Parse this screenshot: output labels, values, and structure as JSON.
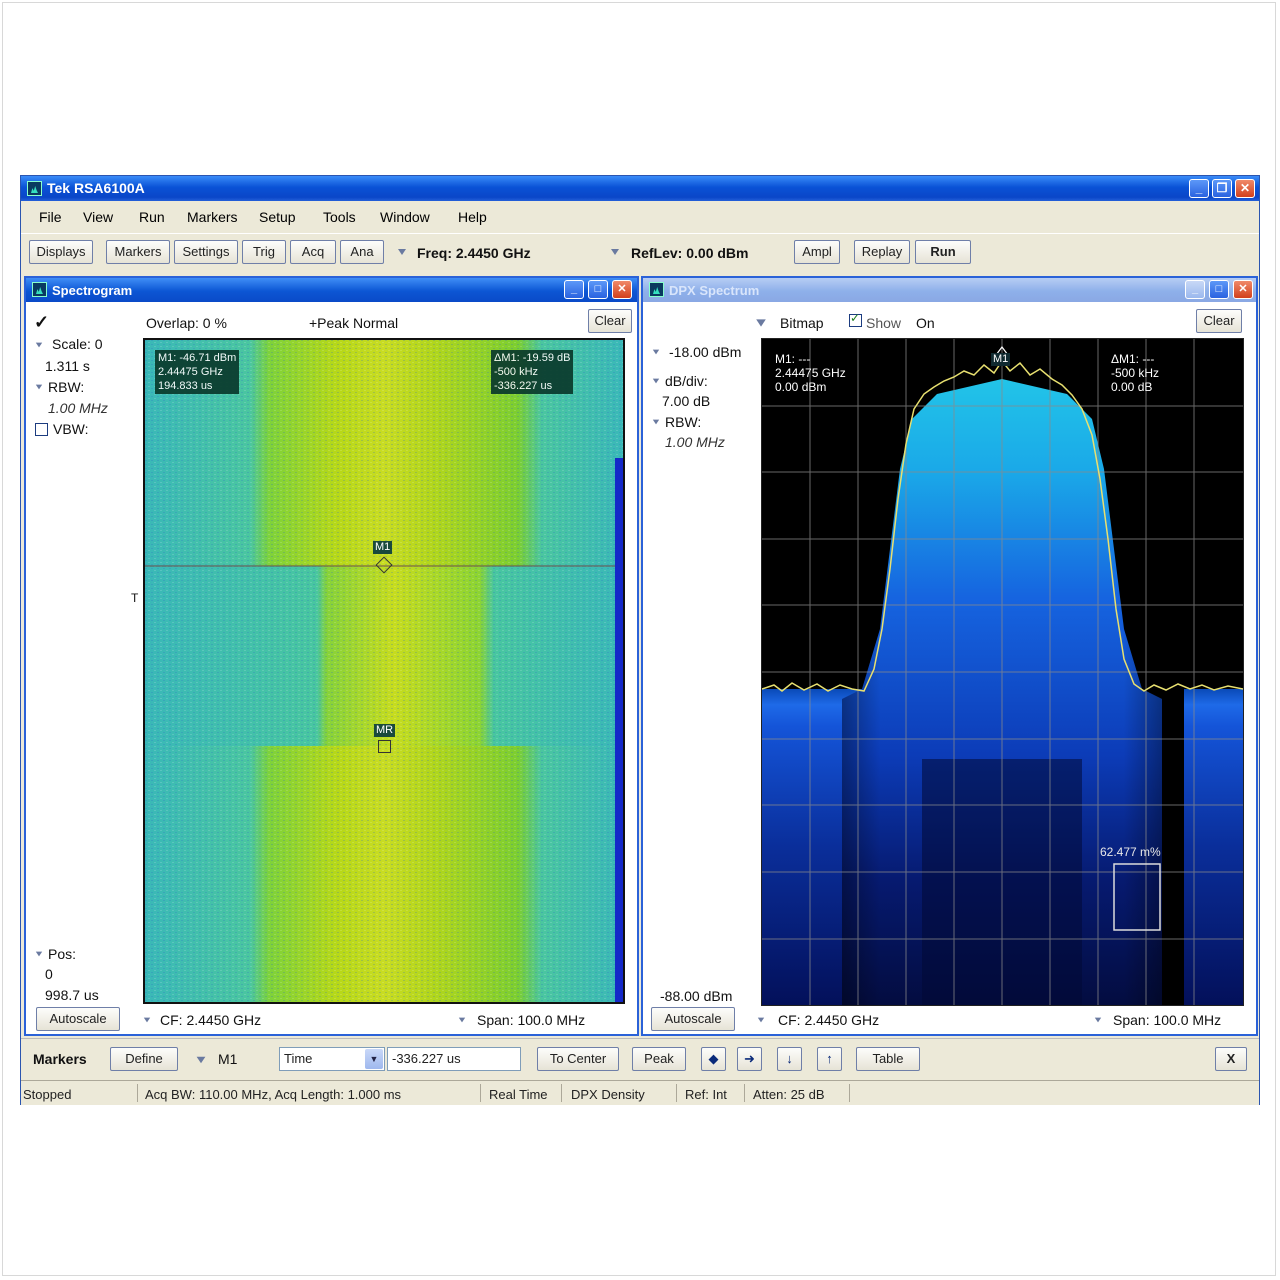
{
  "app": {
    "title": "Tek RSA6100A"
  },
  "menu": [
    "File",
    "View",
    "Run",
    "Markers",
    "Setup",
    "Tools",
    "Window",
    "Help"
  ],
  "toolbar": {
    "displays": "Displays",
    "markers": "Markers",
    "settings": "Settings",
    "trig": "Trig",
    "acq": "Acq",
    "ana": "Ana",
    "freq": "Freq: 2.4450 GHz",
    "reflev": "RefLev: 0.00 dBm",
    "ampl": "Ampl",
    "replay": "Replay",
    "run": "Run"
  },
  "spectrogram": {
    "title": "Spectrogram",
    "check": "✓",
    "overlap": "Overlap: 0 %",
    "trace": "+Peak Normal",
    "clear": "Clear",
    "scale_label": "Scale: 0",
    "scale_value": "1.311 s",
    "rbw_label": "RBW:",
    "rbw_value": "1.00 MHz",
    "vbw_label": "VBW:",
    "pos_label": "Pos:",
    "pos_value": "0",
    "pos_time": "998.7 us",
    "autoscale": "Autoscale",
    "cf": "CF: 2.4450 GHz",
    "span": "Span: 100.0 MHz",
    "m1_readout": "M1: -46.71 dBm\n2.44475 GHz\n194.833 us",
    "delta_readout": "ΔM1: -19.59 dB\n-500 kHz\n-336.227 us",
    "m1_tag": "M1",
    "mr_tag": "MR",
    "t_marker": "T"
  },
  "dpx": {
    "title": "DPX Spectrum",
    "bitmap": "Bitmap",
    "show": "Show",
    "on": "On",
    "clear": "Clear",
    "ref_level": "-18.00 dBm",
    "dbdiv_label": "dB/div:",
    "dbdiv_value": "7.00 dB",
    "rbw_label": "RBW:",
    "rbw_value": "1.00 MHz",
    "bottom_level": "-88.00 dBm",
    "autoscale": "Autoscale",
    "cf": "CF: 2.4450 GHz",
    "span": "Span: 100.0 MHz",
    "m1_readout": "M1: ---\n2.44475 GHz\n0.00 dBm",
    "delta_readout": "ΔM1: ---\n-500 kHz\n0.00 dB",
    "m1_tag": "M1",
    "density": "62.477 m%"
  },
  "markers_bar": {
    "title": "Markers",
    "define": "Define",
    "marker_select": "M1",
    "mode": "Time",
    "value": "-336.227 us",
    "to_center": "To Center",
    "peak": "Peak",
    "table": "Table",
    "close": "X"
  },
  "status": {
    "state": "Stopped",
    "acq": "Acq BW: 110.00 MHz, Acq Length: 1.000 ms",
    "mode": "Real Time",
    "density": "DPX Density",
    "ref": "Ref: Int",
    "atten": "Atten: 25 dB"
  },
  "colors": {
    "accent": "#0a52d6",
    "trace": "#e8e070"
  }
}
